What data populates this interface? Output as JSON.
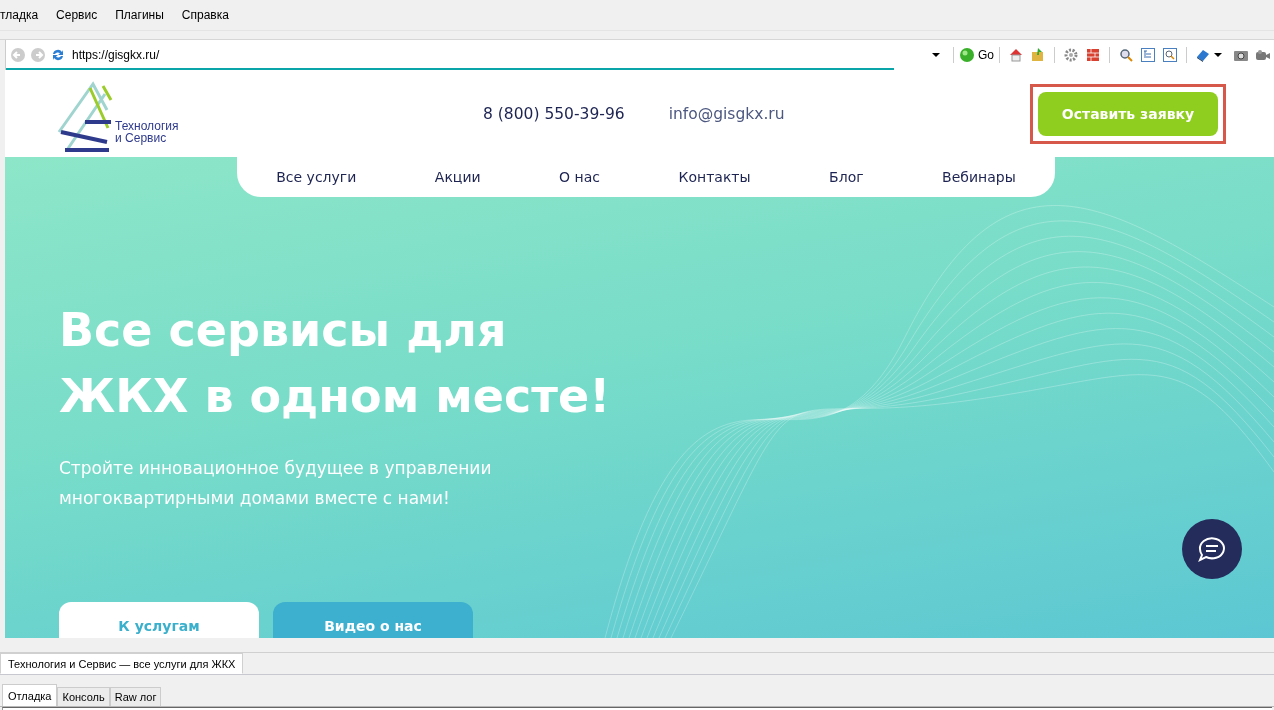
{
  "menu_bar": {
    "items": [
      "тладка",
      "Сервис",
      "Плагины",
      "Справка"
    ]
  },
  "address_bar": {
    "url": "https://gisgkx.ru/",
    "go_label": "Go",
    "level": 0.7
  },
  "page": {
    "logo": {
      "line1": "Технология",
      "line2": "и Сервис"
    },
    "phone": "8 (800) 550-39-96",
    "email": "info@gisgkx.ru",
    "cta_button": {
      "label": "Оставить заявку",
      "highlighted": true
    },
    "nav": [
      "Все услуги",
      "Акции",
      "О нас",
      "Контакты",
      "Блог",
      "Вебинары"
    ],
    "hero": {
      "title": "Все сервисы для\nЖКХ в одном месте!",
      "subtitle": "Стройте инновационное будущее в управлении\nмногоквартирными домами вместе с нами!"
    },
    "buttons": [
      {
        "label": "К услугам",
        "kind": "primary"
      },
      {
        "label": "Видео о нас",
        "kind": "secondary"
      }
    ]
  },
  "page_tabs": [
    {
      "label": "Технология и Сервис — все услуги для ЖКХ",
      "selected": true
    }
  ],
  "panel_tabs": [
    {
      "label": "Отладка",
      "selected": true
    },
    {
      "label": "Консоль",
      "selected": false
    },
    {
      "label": "Raw лог",
      "selected": false
    }
  ]
}
